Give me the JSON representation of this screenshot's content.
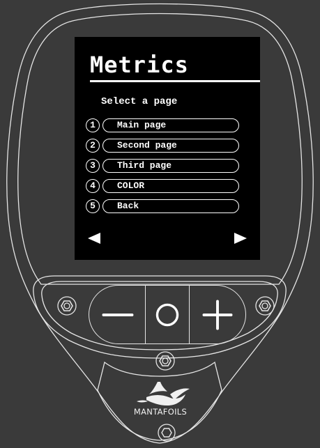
{
  "screen": {
    "title": "Metrics",
    "subtitle": "Select a page",
    "menu": [
      {
        "number": "1",
        "label": "Main page"
      },
      {
        "number": "2",
        "label": "Second page"
      },
      {
        "number": "3",
        "label": "Third page"
      },
      {
        "number": "4",
        "label": "COLOR"
      },
      {
        "number": "5",
        "label": "Back"
      }
    ],
    "nav": {
      "prev_icon": "triangle-left-icon",
      "next_icon": "triangle-right-icon"
    }
  },
  "controls": {
    "minus_icon": "minus-icon",
    "center_icon": "circle-icon",
    "plus_icon": "plus-icon"
  },
  "brand": {
    "name": "MANTAFOILS",
    "logo_icon": "manta-logo-icon"
  },
  "colors": {
    "background": "#3a3a3a",
    "device_outline": "#e6e6e6",
    "screen": "#000000",
    "text": "#ffffff"
  }
}
